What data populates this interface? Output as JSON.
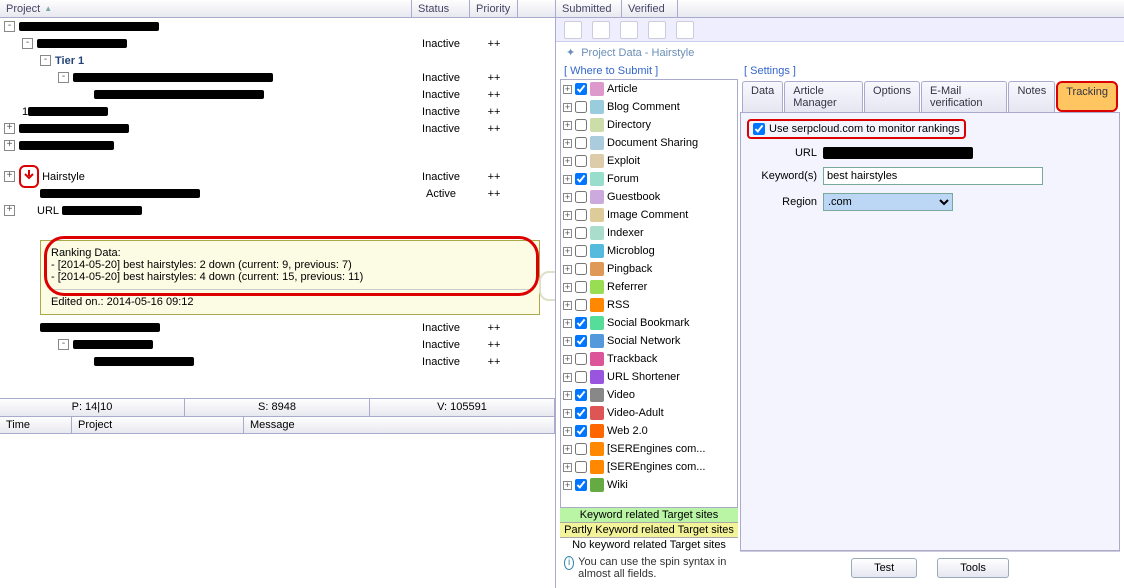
{
  "grid_headers": {
    "project": "Project",
    "status": "Status",
    "priority": "Priority",
    "submitted": "Submitted",
    "verified": "Verified"
  },
  "status_inactive": "Inactive",
  "status_active": "Active",
  "prio_pp": "++",
  "tree": {
    "tier1": "Tier 1",
    "hairstyle_label": "Hairstyle",
    "url_prefix": "URL"
  },
  "tooltip": {
    "title": "Ranking Data:",
    "line1": "- [2014-05-20] best hairstyles: 2 down (current: 9, previous: 7)",
    "line2": "- [2014-05-20] best hairstyles: 4 down (current: 15, previous: 11)",
    "edited": "Edited on.: 2014-05-16 09:12"
  },
  "statusbar": {
    "p": "P: 14|10",
    "s": "S: 8948",
    "v": "V: 105591"
  },
  "log_headers": {
    "time": "Time",
    "project": "Project",
    "message": "Message"
  },
  "panel_title": "Project Data - Hairstyle",
  "wts_label": "[ Where to Submit ]",
  "settings_label": "[ Settings ]",
  "wts_items": [
    "Article",
    "Blog Comment",
    "Directory",
    "Document Sharing",
    "Exploit",
    "Forum",
    "Guestbook",
    "Image Comment",
    "Indexer",
    "Microblog",
    "Pingback",
    "Referrer",
    "RSS",
    "Social Bookmark",
    "Social Network",
    "Trackback",
    "URL Shortener",
    "Video",
    "Video-Adult",
    "Web 2.0",
    "[SEREngines com...",
    "[SEREngines com...",
    "Wiki"
  ],
  "wts_checked": [
    true,
    false,
    false,
    false,
    false,
    true,
    false,
    false,
    false,
    false,
    false,
    false,
    false,
    true,
    true,
    false,
    false,
    true,
    true,
    true,
    false,
    false,
    true
  ],
  "legend": {
    "l1": "Keyword related Target sites",
    "l2": "Partly Keyword related Target sites",
    "l3": "No keyword related Target sites"
  },
  "hint": "You can use the spin syntax in almost all fields.",
  "tabs": [
    "Data",
    "Article Manager",
    "Options",
    "E-Mail verification",
    "Notes",
    "Tracking"
  ],
  "settings": {
    "use_serpcloud": "Use serpcloud.com to monitor rankings",
    "url_label": "URL",
    "keywords_label": "Keyword(s)",
    "keywords_value": "best hairstyles",
    "region_label": "Region",
    "region_value": ".com"
  },
  "buttons": {
    "test": "Test",
    "tools": "Tools"
  }
}
